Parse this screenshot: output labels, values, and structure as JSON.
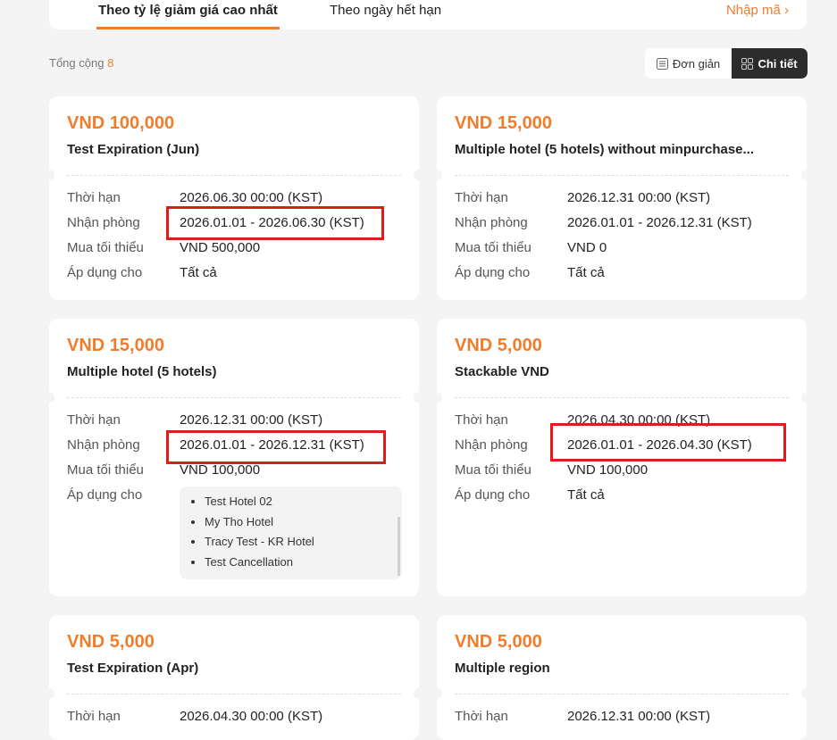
{
  "tabs": [
    {
      "label": "Theo tỷ lệ giảm giá cao nhất",
      "active": true
    },
    {
      "label": "Theo ngày hết hạn",
      "active": false
    }
  ],
  "enter_code": "Nhập mã ›",
  "total": {
    "label": "Tổng cộng",
    "count": "8"
  },
  "view_toggle": {
    "simple": "Đơn giản",
    "detail": "Chi tiết",
    "selected": "detail"
  },
  "labels": {
    "expiry": "Thời hạn",
    "checkin": "Nhận phòng",
    "min": "Mua tối thiểu",
    "apply": "Áp dụng cho"
  },
  "coupons": [
    {
      "amount": "VND 100,000",
      "title": "Test Expiration (Jun)",
      "expiry": "2026.06.30 00:00 (KST)",
      "checkin": "2026.01.01 - 2026.06.30 (KST)",
      "min": "VND 500,000",
      "apply": "Tất cả",
      "highlighted": true
    },
    {
      "amount": "VND 15,000",
      "title": "Multiple hotel (5 hotels) without minpurchase...",
      "expiry": "2026.12.31 00:00 (KST)",
      "checkin": "2026.01.01 - 2026.12.31 (KST)",
      "min": "VND 0",
      "apply": "Tất cả",
      "highlighted": false
    },
    {
      "amount": "VND 15,000",
      "title": "Multiple hotel (5 hotels)",
      "expiry": "2026.12.31 00:00 (KST)",
      "checkin": "2026.01.01 - 2026.12.31 (KST)",
      "min": "VND 100,000",
      "hotels": [
        "Test Hotel 02",
        "My Tho Hotel",
        "Tracy Test - KR Hotel",
        "Test Cancellation"
      ],
      "highlighted": true
    },
    {
      "amount": "VND 5,000",
      "title": "Stackable VND",
      "expiry": "2026.04.30 00:00 (KST)",
      "checkin": "2026.01.01 - 2026.04.30 (KST)",
      "min": "VND 100,000",
      "apply": "Tất cả",
      "highlighted": true
    },
    {
      "amount": "VND 5,000",
      "title": "Test Expiration (Apr)",
      "expiry": "2026.04.30 00:00 (KST)"
    },
    {
      "amount": "VND 5,000",
      "title": "Multiple region",
      "expiry": "2026.12.31 00:00 (KST)"
    }
  ]
}
